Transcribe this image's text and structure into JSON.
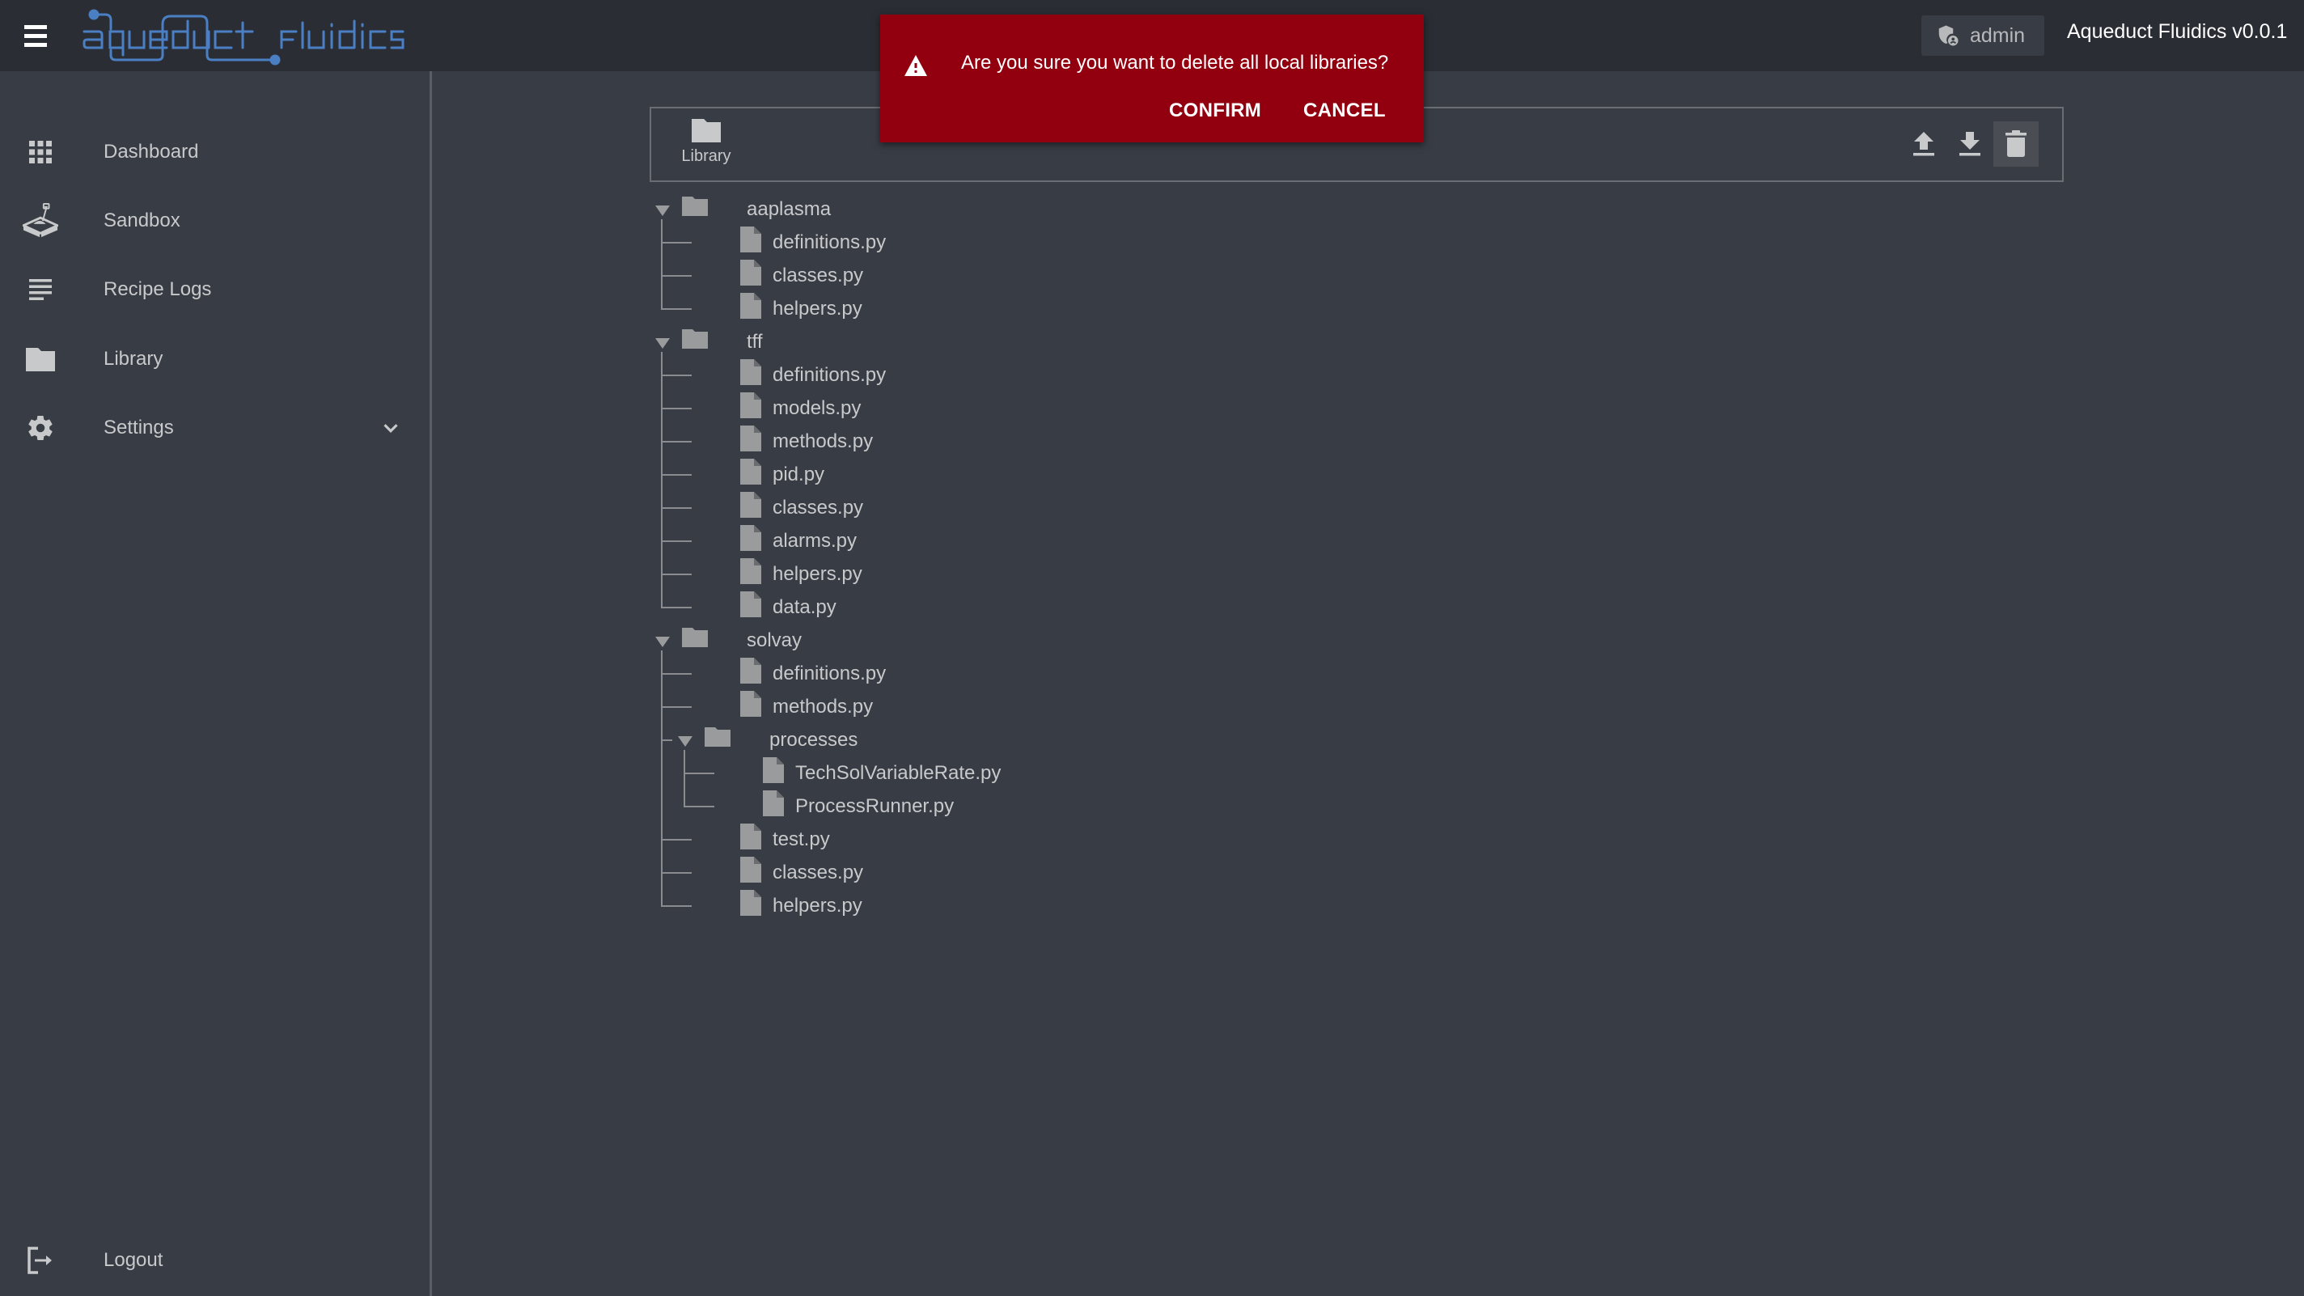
{
  "header": {
    "menu_icon": "hamburger-menu-icon",
    "logo_text": "aqueduct fluidics",
    "logo_color": "#4a7fc4",
    "user_badge": {
      "icon": "admin-shield-icon",
      "label": "admin"
    },
    "app_version": "Aqueduct Fluidics v0.0.1"
  },
  "sidebar": {
    "items": [
      {
        "id": "dashboard",
        "icon": "grid-icon",
        "label": "Dashboard"
      },
      {
        "id": "sandbox",
        "icon": "sandbox-icon",
        "label": "Sandbox"
      },
      {
        "id": "recipe-logs",
        "icon": "list-lines-icon",
        "label": "Recipe Logs"
      },
      {
        "id": "library",
        "icon": "folder-icon",
        "label": "Library"
      },
      {
        "id": "settings",
        "icon": "gear-icon",
        "label": "Settings",
        "expandable": true
      }
    ],
    "logout": {
      "icon": "logout-icon",
      "label": "Logout"
    }
  },
  "library_panel": {
    "tab_label": "Library",
    "tab_icon": "folder-icon",
    "toolbar": [
      {
        "id": "upload",
        "icon": "upload-icon"
      },
      {
        "id": "download",
        "icon": "download-icon"
      },
      {
        "id": "delete",
        "icon": "trash-icon",
        "active": true
      }
    ]
  },
  "tree": [
    {
      "type": "folder",
      "name": "aaplasma",
      "expanded": true,
      "children": [
        {
          "type": "file",
          "name": "definitions.py"
        },
        {
          "type": "file",
          "name": "classes.py"
        },
        {
          "type": "file",
          "name": "helpers.py"
        }
      ]
    },
    {
      "type": "folder",
      "name": "tff",
      "expanded": true,
      "children": [
        {
          "type": "file",
          "name": "definitions.py"
        },
        {
          "type": "file",
          "name": "models.py"
        },
        {
          "type": "file",
          "name": "methods.py"
        },
        {
          "type": "file",
          "name": "pid.py"
        },
        {
          "type": "file",
          "name": "classes.py"
        },
        {
          "type": "file",
          "name": "alarms.py"
        },
        {
          "type": "file",
          "name": "helpers.py"
        },
        {
          "type": "file",
          "name": "data.py"
        }
      ]
    },
    {
      "type": "folder",
      "name": "solvay",
      "expanded": true,
      "children": [
        {
          "type": "file",
          "name": "definitions.py"
        },
        {
          "type": "file",
          "name": "methods.py"
        },
        {
          "type": "folder",
          "name": "processes",
          "expanded": true,
          "children": [
            {
              "type": "file",
              "name": "TechSolVariableRate.py"
            },
            {
              "type": "file",
              "name": "ProcessRunner.py"
            }
          ]
        },
        {
          "type": "file",
          "name": "test.py"
        },
        {
          "type": "file",
          "name": "classes.py"
        },
        {
          "type": "file",
          "name": "helpers.py"
        }
      ]
    }
  ],
  "dialog": {
    "icon": "warning-icon",
    "message": "Are you sure you want to delete all local libraries?",
    "confirm_label": "CONFIRM",
    "cancel_label": "CANCEL",
    "background": "#920010"
  }
}
